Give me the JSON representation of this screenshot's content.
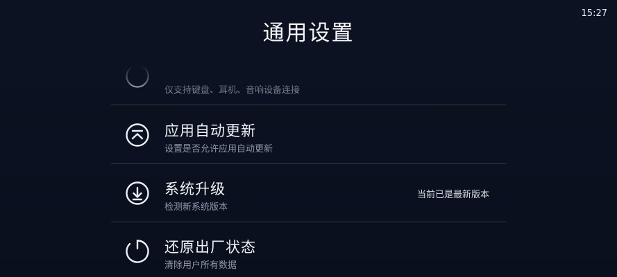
{
  "status_bar": {
    "time": "15:27"
  },
  "header": {
    "title": "通用设置"
  },
  "items": [
    {
      "label": "",
      "desc": "仅支持键盘、耳机、音响设备连接",
      "value": "",
      "icon": "bluetooth-icon"
    },
    {
      "label": "应用自动更新",
      "desc": "设置是否允许应用自动更新",
      "value": "",
      "icon": "auto-update-icon"
    },
    {
      "label": "系统升级",
      "desc": "检测新系统版本",
      "value": "当前已是最新版本",
      "icon": "download-icon"
    },
    {
      "label": "还原出厂状态",
      "desc": "清除用户所有数据",
      "value": "",
      "icon": "power-icon"
    }
  ],
  "colors": {
    "background": "#0b1120",
    "divider": "#3a4150",
    "text": "#eef1f6",
    "subtext": "#8f97a6"
  }
}
